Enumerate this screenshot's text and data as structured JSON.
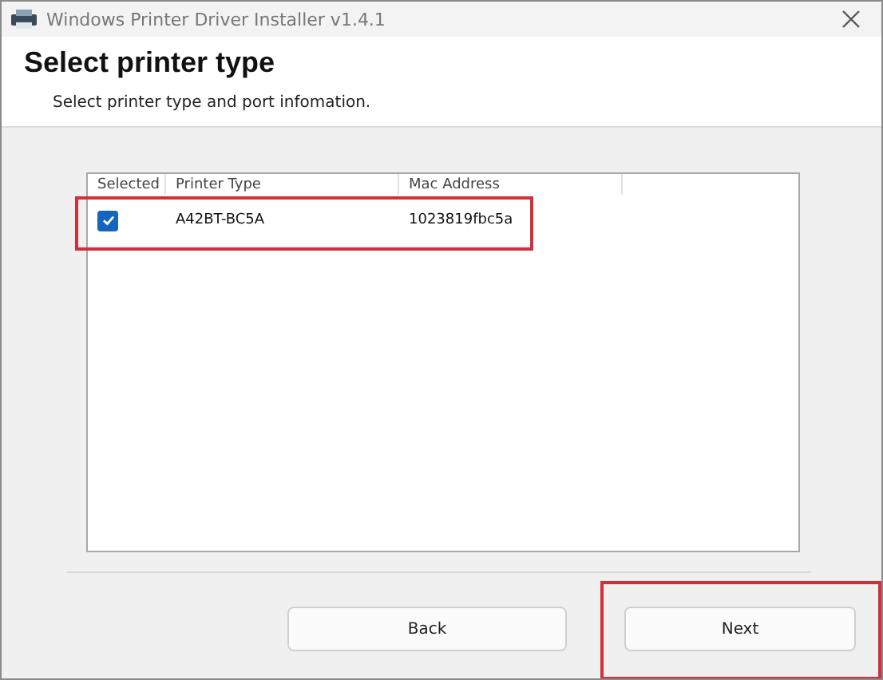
{
  "window": {
    "title": "Windows Printer Driver Installer v1.4.1"
  },
  "header": {
    "title": "Select printer type",
    "subtitle": "Select printer type and port infomation."
  },
  "table": {
    "columns": [
      "Selected",
      "Printer Type",
      "Mac Address"
    ],
    "rows": [
      {
        "highlighted": true,
        "cells": [
          {
            "kind": "checkbox",
            "checked": true
          },
          {
            "kind": "text",
            "text": "A42BT-BC5A"
          },
          {
            "kind": "text",
            "text": "1023819fbc5a"
          }
        ]
      }
    ]
  },
  "buttons": [
    {
      "label": "Back",
      "highlighted": false
    },
    {
      "label": "Next",
      "highlighted": true
    }
  ]
}
